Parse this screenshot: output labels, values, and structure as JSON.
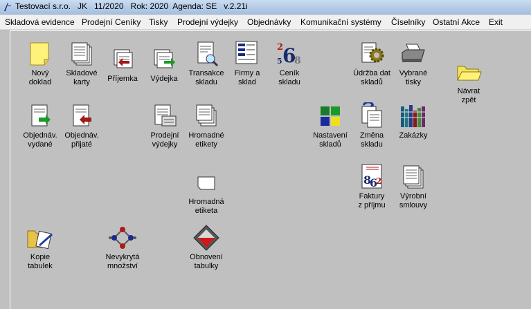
{
  "window": {
    "title": "Testovací s.r.o.   JK   11/2020   Rok: 2020  Agenda: SE   v.2.21i"
  },
  "menu": [
    "Skladová evidence",
    "Prodejní Ceníky",
    "Tisky",
    "Prodejní výdejky",
    "Objednávky",
    "Komunikační systémy",
    "Číselníky",
    "Ostatní Akce",
    "Exit"
  ],
  "tiles": {
    "novy_doklad": "Nový\ndoklad",
    "skladove_karty": "Skladové\nkarty",
    "prijemka": "Příjemka",
    "vydejka": "Výdejka",
    "transakce_skladu": "Transakce\nskladu",
    "firmy_sklad": "Firmy a\nsklad",
    "cenik_skladu": "Ceník\nskladu",
    "udrzba_dat": "Údržba dat\nskladů",
    "vybrane_tisky": "Vybrané\ntisky",
    "navrat_zpet": "Návrat\nzpět",
    "objednav_vydane": "Objednáv.\nvydané",
    "objednav_prijate": "Objednáv.\npřijaté",
    "prodejni_vydejky": "Prodejní\nvýdejky",
    "hromadne_etikety": "Hromadné\netikety",
    "nastaveni_skladu": "Nastavení\nskladů",
    "zmena_skladu": "Změna\nskladu",
    "zakazky": "Zakázky",
    "hromadna_etiketa": "Hromadná\netiketa",
    "faktury_z_prijmu": "Faktury\nz příjmu",
    "vyrobni_smlouvy": "Výrobní\nsmlouvy",
    "kopie_tabulek": "Kopie\ntabulek",
    "nevykryta_mnozstvi": "Nevykrytá\nmnožství",
    "obnoveni_tabulky": "Obnovení\ntabulky"
  }
}
